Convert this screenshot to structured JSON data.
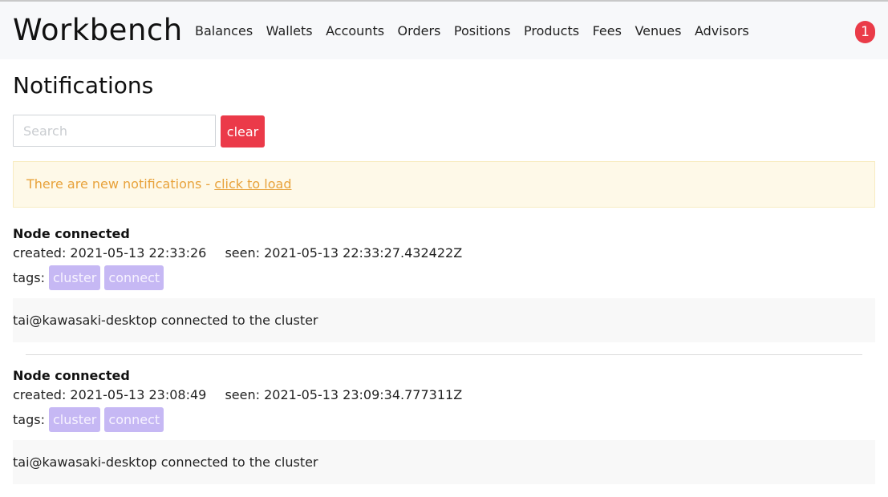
{
  "header": {
    "brand": "Workbench",
    "nav": [
      "Balances",
      "Wallets",
      "Accounts",
      "Orders",
      "Positions",
      "Products",
      "Fees",
      "Venues",
      "Advisors"
    ],
    "notification_count": "1"
  },
  "page": {
    "title": "Notifications",
    "search_placeholder": "Search",
    "clear_label": "clear"
  },
  "alert": {
    "text": "There are new notifications - ",
    "link": "click to load"
  },
  "notifications": [
    {
      "title": "Node connected",
      "created": "created: 2021-05-13 22:33:26",
      "seen": "seen: 2021-05-13 22:33:27.432422Z",
      "tags_label": "tags:",
      "tags": [
        "cluster",
        "connect"
      ],
      "message": "tai@kawasaki-desktop connected to the cluster"
    },
    {
      "title": "Node connected",
      "created": "created: 2021-05-13 23:08:49",
      "seen": "seen: 2021-05-13 23:09:34.777311Z",
      "tags_label": "tags:",
      "tags": [
        "cluster",
        "connect"
      ],
      "message": "tai@kawasaki-desktop connected to the cluster"
    }
  ],
  "colors": {
    "badge": "#ea3b48",
    "clear_button": "#eb3a49",
    "alert_text": "#e8a23a",
    "tag_bg": "#c6b8f4"
  }
}
